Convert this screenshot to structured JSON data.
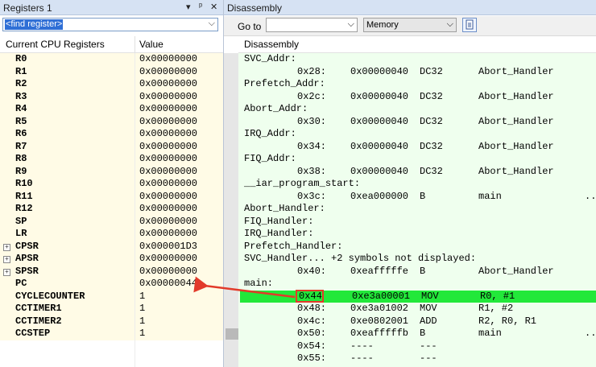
{
  "left_panel": {
    "title": "Registers 1",
    "controls": [
      "▾",
      "ᵖ",
      "✕"
    ],
    "find_placeholder": "<find register>",
    "headers": [
      "Current CPU Registers",
      "Value"
    ],
    "registers": [
      {
        "name": "R0",
        "value": "0x00000000",
        "expandable": false
      },
      {
        "name": "R1",
        "value": "0x00000000",
        "expandable": false
      },
      {
        "name": "R2",
        "value": "0x00000000",
        "expandable": false
      },
      {
        "name": "R3",
        "value": "0x00000000",
        "expandable": false
      },
      {
        "name": "R4",
        "value": "0x00000000",
        "expandable": false
      },
      {
        "name": "R5",
        "value": "0x00000000",
        "expandable": false
      },
      {
        "name": "R6",
        "value": "0x00000000",
        "expandable": false
      },
      {
        "name": "R7",
        "value": "0x00000000",
        "expandable": false
      },
      {
        "name": "R8",
        "value": "0x00000000",
        "expandable": false
      },
      {
        "name": "R9",
        "value": "0x00000000",
        "expandable": false
      },
      {
        "name": "R10",
        "value": "0x00000000",
        "expandable": false
      },
      {
        "name": "R11",
        "value": "0x00000000",
        "expandable": false
      },
      {
        "name": "R12",
        "value": "0x00000000",
        "expandable": false
      },
      {
        "name": "SP",
        "value": "0x00000000",
        "expandable": false
      },
      {
        "name": "LR",
        "value": "0x00000000",
        "expandable": false
      },
      {
        "name": "CPSR",
        "value": "0x000001D3",
        "expandable": true
      },
      {
        "name": "APSR",
        "value": "0x00000000",
        "expandable": true
      },
      {
        "name": "SPSR",
        "value": "0x00000000",
        "expandable": true
      },
      {
        "name": "PC",
        "value": "0x00000044",
        "expandable": false
      },
      {
        "name": "CYCLECOUNTER",
        "value": "1",
        "expandable": false
      },
      {
        "name": "CCTIMER1",
        "value": "1",
        "expandable": false
      },
      {
        "name": "CCTIMER2",
        "value": "1",
        "expandable": false
      },
      {
        "name": "CCSTEP",
        "value": "1",
        "expandable": false
      }
    ]
  },
  "right_panel": {
    "title": "Disassembly",
    "toolbar": {
      "goto_label": "Go to",
      "goto_value": "",
      "memory_select": "Memory"
    },
    "header": "Disassembly",
    "lines": [
      {
        "kind": "label",
        "text": "SVC_Addr:"
      },
      {
        "kind": "instr",
        "addr": "0x28:",
        "code": "0x00000040",
        "mnemonic": "DC32",
        "operands": "Abort_Handler",
        "dots": ""
      },
      {
        "kind": "label",
        "text": "Prefetch_Addr:"
      },
      {
        "kind": "instr",
        "addr": "0x2c:",
        "code": "0x00000040",
        "mnemonic": "DC32",
        "operands": "Abort_Handler",
        "dots": ""
      },
      {
        "kind": "label",
        "text": "Abort_Addr:"
      },
      {
        "kind": "instr",
        "addr": "0x30:",
        "code": "0x00000040",
        "mnemonic": "DC32",
        "operands": "Abort_Handler",
        "dots": ""
      },
      {
        "kind": "label",
        "text": "IRQ_Addr:"
      },
      {
        "kind": "instr",
        "addr": "0x34:",
        "code": "0x00000040",
        "mnemonic": "DC32",
        "operands": "Abort_Handler",
        "dots": ""
      },
      {
        "kind": "label",
        "text": "FIQ_Addr:"
      },
      {
        "kind": "instr",
        "addr": "0x38:",
        "code": "0x00000040",
        "mnemonic": "DC32",
        "operands": "Abort_Handler",
        "dots": ""
      },
      {
        "kind": "label",
        "text": "__iar_program_start:"
      },
      {
        "kind": "instr",
        "addr": "0x3c:",
        "code": "0xea000000",
        "mnemonic": "B",
        "operands": "main",
        "dots": ".."
      },
      {
        "kind": "label",
        "text": "Abort_Handler:"
      },
      {
        "kind": "label",
        "text": "FIQ_Handler:"
      },
      {
        "kind": "label",
        "text": "IRQ_Handler:"
      },
      {
        "kind": "label",
        "text": "Prefetch_Handler:"
      },
      {
        "kind": "label",
        "text": "SVC_Handler... +2 symbols not displayed:"
      },
      {
        "kind": "instr",
        "addr": "0x40:",
        "code": "0xeafffffe",
        "mnemonic": "B",
        "operands": "Abort_Handler",
        "dots": ""
      },
      {
        "kind": "label",
        "text": "main:"
      },
      {
        "kind": "instr",
        "addr": "0x44",
        "code": "0xe3a00001",
        "mnemonic": "MOV",
        "operands": "R0, #1",
        "dots": "",
        "highlight": true
      },
      {
        "kind": "instr",
        "addr": "0x48:",
        "code": "0xe3a01002",
        "mnemonic": "MOV",
        "operands": "R1, #2",
        "dots": ""
      },
      {
        "kind": "instr",
        "addr": "0x4c:",
        "code": "0xe0802001",
        "mnemonic": "ADD",
        "operands": "R2, R0, R1",
        "dots": ""
      },
      {
        "kind": "instr",
        "addr": "0x50:",
        "code": "0xeafffffb",
        "mnemonic": "B",
        "operands": "main",
        "dots": ".."
      },
      {
        "kind": "instr",
        "addr": "0x54:",
        "code": "----",
        "mnemonic": "---",
        "operands": "",
        "dots": ""
      },
      {
        "kind": "instr",
        "addr": "0x55:",
        "code": "----",
        "mnemonic": "---",
        "operands": "",
        "dots": ""
      }
    ]
  },
  "annotation": {
    "from_register": "PC",
    "to_address": "0x44",
    "color": "#e23a2a"
  },
  "colors": {
    "highlight": "#22e83a",
    "disasm_bg": "#efffee",
    "reg_bg": "#fffbe6",
    "titlebar": "#d6e2f3"
  }
}
